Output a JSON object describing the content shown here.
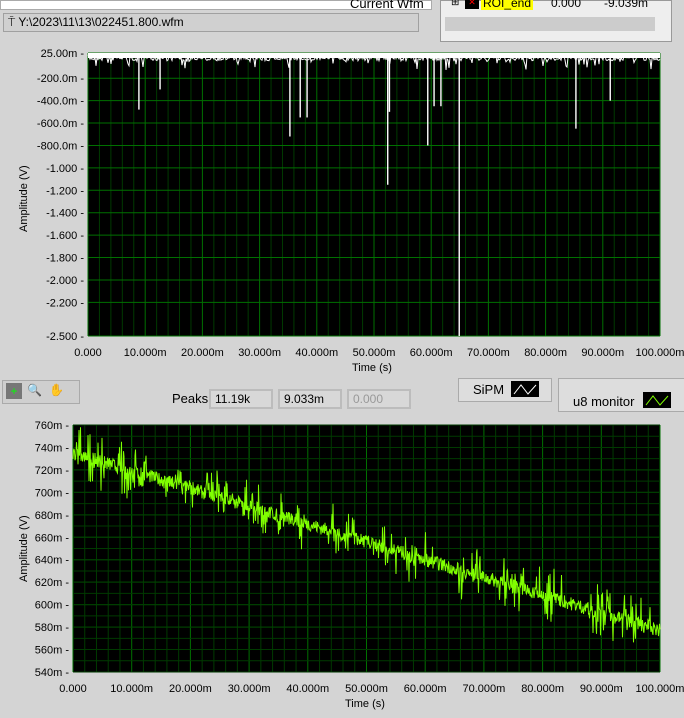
{
  "file_path": "Y:\\2023\\11\\13\\022451.800.wfm",
  "current_wfm_label": "Current Wfm",
  "roi_table": {
    "name": "ROI_end",
    "col1": "0.000",
    "col2": "-9.039m"
  },
  "toolbar": {
    "peaks_label": "Peaks",
    "peaks_count": "11.19k",
    "peaks_value": "9.033m",
    "peaks_disabled": "0.000"
  },
  "legend": {
    "sipm": "SiPM",
    "u8": "u8 monitor"
  },
  "colors": {
    "plot_bg": "#000000",
    "grid": "#006400",
    "sipm": "#ffffff",
    "u8": "#80ff00"
  },
  "chart_data": [
    {
      "type": "line",
      "title": "SiPM",
      "xlabel": "Time (s)",
      "ylabel": "Amplitude (V)",
      "xlim": [
        0,
        100
      ],
      "ylim": [
        -2.5,
        0.025
      ],
      "x_ticks": [
        "0.000",
        "10.000m",
        "20.000m",
        "30.000m",
        "40.000m",
        "50.000m",
        "60.000m",
        "70.000m",
        "80.000m",
        "90.000m",
        "100.000m"
      ],
      "y_ticks": [
        {
          "v": 0.025,
          "l": "25.00m"
        },
        {
          "v": -0.2,
          "l": "-200.0m"
        },
        {
          "v": -0.4,
          "l": "-400.0m"
        },
        {
          "v": -0.6,
          "l": "-600.0m"
        },
        {
          "v": -0.8,
          "l": "-800.0m"
        },
        {
          "v": -1.0,
          "l": "-1.000"
        },
        {
          "v": -1.2,
          "l": "-1.200"
        },
        {
          "v": -1.4,
          "l": "-1.400"
        },
        {
          "v": -1.6,
          "l": "-1.600"
        },
        {
          "v": -1.8,
          "l": "-1.800"
        },
        {
          "v": -2.0,
          "l": "-2.000"
        },
        {
          "v": -2.2,
          "l": "-2.200"
        },
        {
          "v": -2.5,
          "l": "-2.500"
        }
      ],
      "baseline": 0.0,
      "spikes_ms_v": [
        [
          8.9,
          -0.48
        ],
        [
          12.6,
          -0.3
        ],
        [
          35.3,
          -0.72
        ],
        [
          37.1,
          -0.55
        ],
        [
          38.3,
          -0.55
        ],
        [
          52.4,
          -1.15
        ],
        [
          52.7,
          -0.5
        ],
        [
          59.4,
          -0.8
        ],
        [
          60.5,
          -0.45
        ],
        [
          61.7,
          -0.45
        ],
        [
          64.9,
          -2.5
        ],
        [
          85.3,
          -0.65
        ],
        [
          91.3,
          -0.4
        ]
      ]
    },
    {
      "type": "line",
      "title": "u8 monitor",
      "xlabel": "Time (s)",
      "ylabel": "Amplitude (V)",
      "xlim": [
        0,
        100
      ],
      "ylim": [
        0.54,
        0.76
      ],
      "x_ticks": [
        "0.000",
        "10.000m",
        "20.000m",
        "30.000m",
        "40.000m",
        "50.000m",
        "60.000m",
        "70.000m",
        "80.000m",
        "90.000m",
        "100.000m"
      ],
      "y_ticks": [
        "760m",
        "740m",
        "720m",
        "700m",
        "680m",
        "660m",
        "640m",
        "620m",
        "600m",
        "580m",
        "560m",
        "540m"
      ],
      "start_value": 0.735,
      "end_value": 0.577,
      "burst_centers_ms": [
        3,
        10,
        18,
        25,
        31,
        37,
        46,
        53,
        59,
        67,
        75,
        81,
        90,
        96
      ]
    }
  ]
}
